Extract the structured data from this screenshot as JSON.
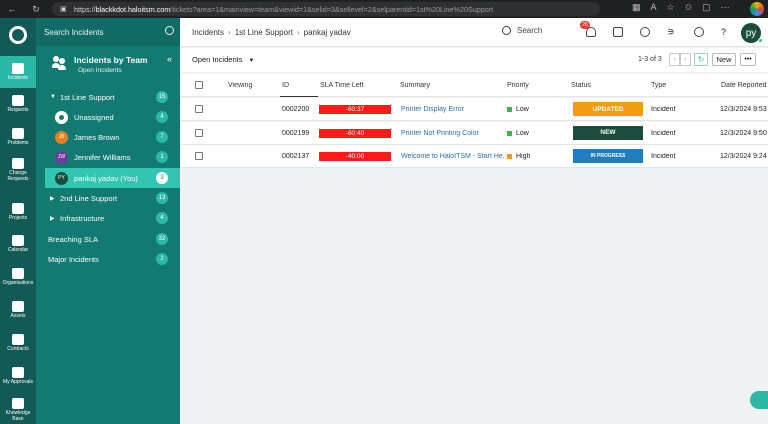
{
  "browser": {
    "url_host": "blackkdot.haloitsm.com",
    "url_rest": "/tickets?area=1&mainview=team&viewid=1&selid=3&sellevel=2&selparentid=1st%20Line%20Support"
  },
  "rail": {
    "items": [
      {
        "label": "Incidents",
        "active": true
      },
      {
        "label": "Requests"
      },
      {
        "label": "Problems"
      },
      {
        "label": "Change Requests"
      },
      {
        "label": "Projects"
      },
      {
        "label": "Calendar"
      },
      {
        "label": "Organisations"
      },
      {
        "label": "Assets"
      },
      {
        "label": "Contracts"
      },
      {
        "label": "My Approvals"
      },
      {
        "label": "Knowledge Base"
      }
    ]
  },
  "panel": {
    "search_placeholder": "Search Incidents",
    "title": "Incidents by Team",
    "subtitle": "Open Incidents",
    "tree": [
      {
        "label": "1st Line Support",
        "count": "15",
        "expanded": true
      },
      {
        "label": "2nd Line Support",
        "count": "13"
      },
      {
        "label": "Infrastructure",
        "count": "4"
      },
      {
        "label": "Breaching SLA",
        "count": "32"
      },
      {
        "label": "Major Incidents",
        "count": "2"
      }
    ],
    "agents": [
      {
        "label": "Unassigned",
        "count": "4",
        "avatar": "",
        "color": "#ffffff"
      },
      {
        "label": "James Brown",
        "count": "7",
        "avatar": "JB",
        "color": "#e67e22"
      },
      {
        "label": "Jennifer Williams",
        "count": "1",
        "avatar": "JW",
        "color": "#6a3d9a"
      },
      {
        "label": "pankaj yadav (You)",
        "count": "3",
        "avatar": "PY",
        "color": "#1b4d3e",
        "active": true
      }
    ]
  },
  "topbar": {
    "breadcrumb": [
      "Incidents",
      "1st Line Support",
      "pankaj yadav"
    ],
    "search_label": "Search",
    "notif_count": "20",
    "user_initials": "py"
  },
  "toolbar": {
    "view": "Open Incidents",
    "pager": "1-3 of 3",
    "new_label": "New",
    "more_label": "•••"
  },
  "table": {
    "headers": [
      "Viewing",
      "ID",
      "SLA Time Left",
      "Summary",
      "Priority",
      "Status",
      "Type",
      "Date Reported"
    ],
    "rows": [
      {
        "id": "0002200",
        "sla": "-60:37",
        "summary": "Printer Display Error",
        "priority": "Low",
        "priority_color": "#3cb44b",
        "status": "UPDATED",
        "status_color": "#f39c12",
        "type": "Incident",
        "date": "12/3/2024 9:53"
      },
      {
        "id": "0002199",
        "sla": "-60:40",
        "summary": "Printer Not Printing Color",
        "priority": "Low",
        "priority_color": "#3cb44b",
        "status": "NEW",
        "status_color": "#1b4d3e",
        "type": "Incident",
        "date": "12/3/2024 9:50"
      },
      {
        "id": "0002137",
        "sla": "-40:00",
        "summary": "Welcome to HaloITSM - Start He...",
        "priority": "High",
        "priority_color": "#f39c12",
        "status": "IN PROGRESS",
        "status_color": "#1f7ec0",
        "type": "Incident",
        "date": "12/3/2024 9:24"
      }
    ]
  }
}
